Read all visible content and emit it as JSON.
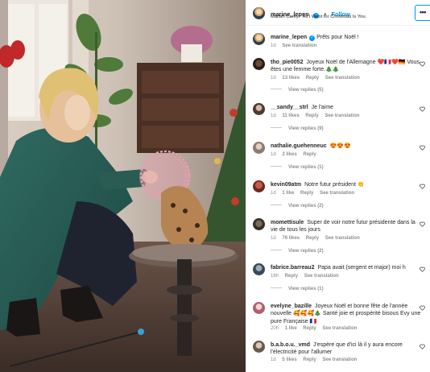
{
  "header": {
    "username": "marine_lepen",
    "follow_label": "Follow",
    "dot": "•",
    "audio": "Mariah Carey · All I Want for Christmas Is You",
    "more_label": "•••",
    "verified_glyph": "✓"
  },
  "caption": {
    "username": "marine_lepen",
    "text": "Prêts pour Noël !",
    "time": "1d",
    "see_translation": "See translation"
  },
  "comments": [
    {
      "username": "tho_pie0052",
      "text": "Joyeux Noël de l'Allemagne ❤️🇫🇷❤️🇩🇪 Vous êtes une femme forte.🎄🎄",
      "time": "1d",
      "likes": "13 likes",
      "reply": "Reply",
      "see_translation": "See translation",
      "view_replies": "View replies (5)"
    },
    {
      "username": "__sandy__strl",
      "text": "Je l'aime",
      "time": "1d",
      "likes": "11 likes",
      "reply": "Reply",
      "see_translation": "See translation",
      "view_replies": "View replies (9)"
    },
    {
      "username": "nathalie.guehenneuc",
      "text": "😍😍😍",
      "time": "1d",
      "likes": "2 likes",
      "reply": "Reply",
      "see_translation": "",
      "view_replies": "View replies (1)"
    },
    {
      "username": "kevin09atm",
      "text": "Notre futur président 👏",
      "time": "1d",
      "likes": "1 like",
      "reply": "Reply",
      "see_translation": "See translation",
      "view_replies": "View replies (2)"
    },
    {
      "username": "momettisule",
      "text": "Super de voir notre futur présidente dans la vie de tous les jours",
      "time": "1d",
      "likes": "76 likes",
      "reply": "Reply",
      "see_translation": "See translation",
      "view_replies": "View replies (2)"
    },
    {
      "username": "fabrice.barreau2",
      "text": "Papa avait (sergent et major) moi h",
      "time": "16h",
      "likes": "",
      "reply": "Reply",
      "see_translation": "See translation",
      "view_replies": "View replies (1)"
    },
    {
      "username": "evelyne_bazille",
      "text": "Joyeux Noël et bonne fête de l'année nouvelle 🥰🥰🥰🎄 Santé joie et prospérité bisous Evy une pure Française 🇫🇷",
      "time": "20h",
      "likes": "1 like",
      "reply": "Reply",
      "see_translation": "See translation",
      "view_replies": ""
    },
    {
      "username": "b.a.b.o.u._vmd",
      "text": "J'espère que d'ici là il y aura encore l'électricité pour l'allumer",
      "time": "1d",
      "likes": "5 likes",
      "reply": "Reply",
      "see_translation": "See translation",
      "view_replies": ""
    }
  ],
  "icons": {
    "heart": "heart-outline-icon",
    "verified": "verified-badge-icon",
    "more": "more-options-icon"
  },
  "colors": {
    "accent": "#0095f6",
    "muted": "#8e8e8e",
    "text": "#262626"
  }
}
